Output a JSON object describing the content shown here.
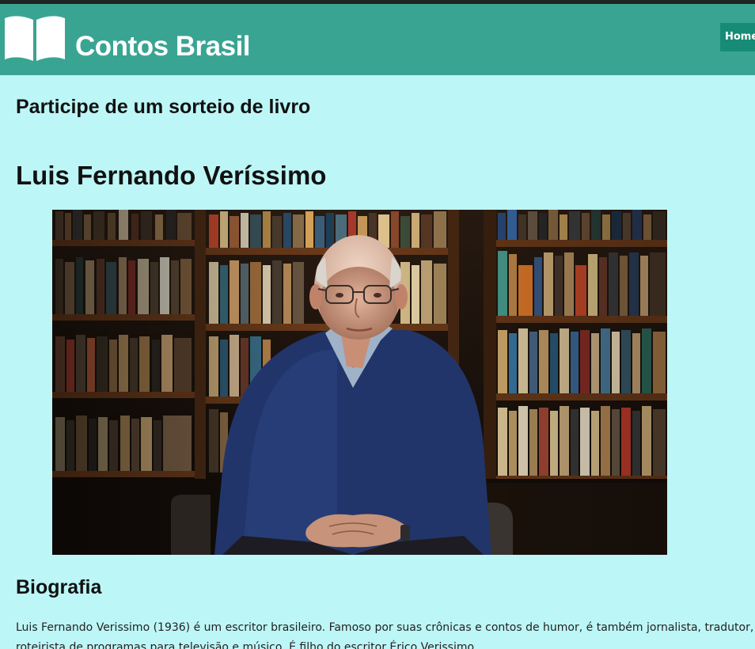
{
  "header": {
    "brand": "Contos Brasil",
    "logo_icon": "open-book-icon",
    "nav": {
      "home_label": "Home"
    }
  },
  "main": {
    "promo_text": "Participe de um sorteio de livro",
    "author_name": "Luis Fernando Veríssimo",
    "portrait_description_icon": "author-portrait-photo",
    "bio_heading": "Biografia",
    "bio_text": "Luis Fernando Verissimo (1936) é um escritor brasileiro. Famoso por suas crônicas e contos de humor, é também jornalista, tradutor, roteirista de programas para televisão e músico. É filho do escritor Érico Verissimo."
  },
  "colors": {
    "header_bg": "#3aa493",
    "nav_button_bg": "#168c76",
    "page_bg": "#bdf6f6"
  }
}
